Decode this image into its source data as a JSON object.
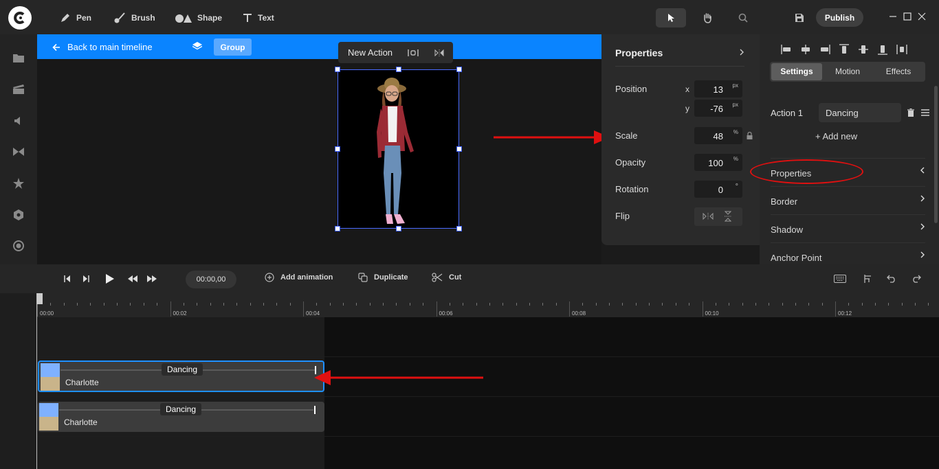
{
  "topbar": {
    "tools": [
      {
        "label": "Pen",
        "icon": "pen-icon"
      },
      {
        "label": "Brush",
        "icon": "brush-icon"
      },
      {
        "label": "Shape",
        "icon": "shape-icon"
      },
      {
        "label": "Text",
        "icon": "text-icon"
      }
    ],
    "publish_label": "Publish"
  },
  "canvas": {
    "back_label": "Back to main timeline",
    "group_label": "Group",
    "new_action_label": "New Action"
  },
  "properties_popup": {
    "title": "Properties",
    "position_label": "Position",
    "x_axis": "x",
    "y_axis": "y",
    "x_value": "13",
    "y_value": "-76",
    "px_unit": "px",
    "scale_label": "Scale",
    "scale_value": "48",
    "percent_unit": "%",
    "opacity_label": "Opacity",
    "opacity_value": "100",
    "rotation_label": "Rotation",
    "rotation_value": "0",
    "degree_unit": "°",
    "flip_label": "Flip"
  },
  "right_panel": {
    "tabs": [
      "Settings",
      "Motion",
      "Effects"
    ],
    "active_tab": "Settings",
    "action_label": "Action 1",
    "action_value": "Dancing",
    "add_new_label": "+ Add new",
    "sections": [
      {
        "label": "Properties",
        "expanded": true
      },
      {
        "label": "Border",
        "expanded": false
      },
      {
        "label": "Shadow",
        "expanded": false
      },
      {
        "label": "Anchor Point",
        "expanded": false
      }
    ]
  },
  "timeline_toolbar": {
    "time": "00:00,00",
    "add_animation_label": "Add animation",
    "duplicate_label": "Duplicate",
    "cut_label": "Cut"
  },
  "ruler": {
    "labels": [
      "00:00",
      "00:02",
      "00:04",
      "00:06",
      "00:08",
      "00:10",
      "00:12"
    ]
  },
  "tracks": [
    {
      "action": "Dancing",
      "name": "Charlotte",
      "selected": true
    },
    {
      "action": "Dancing",
      "name": "Charlotte",
      "selected": false
    }
  ],
  "colors": {
    "accent_blue": "#0a84ff",
    "annotation_red": "#e01010"
  }
}
